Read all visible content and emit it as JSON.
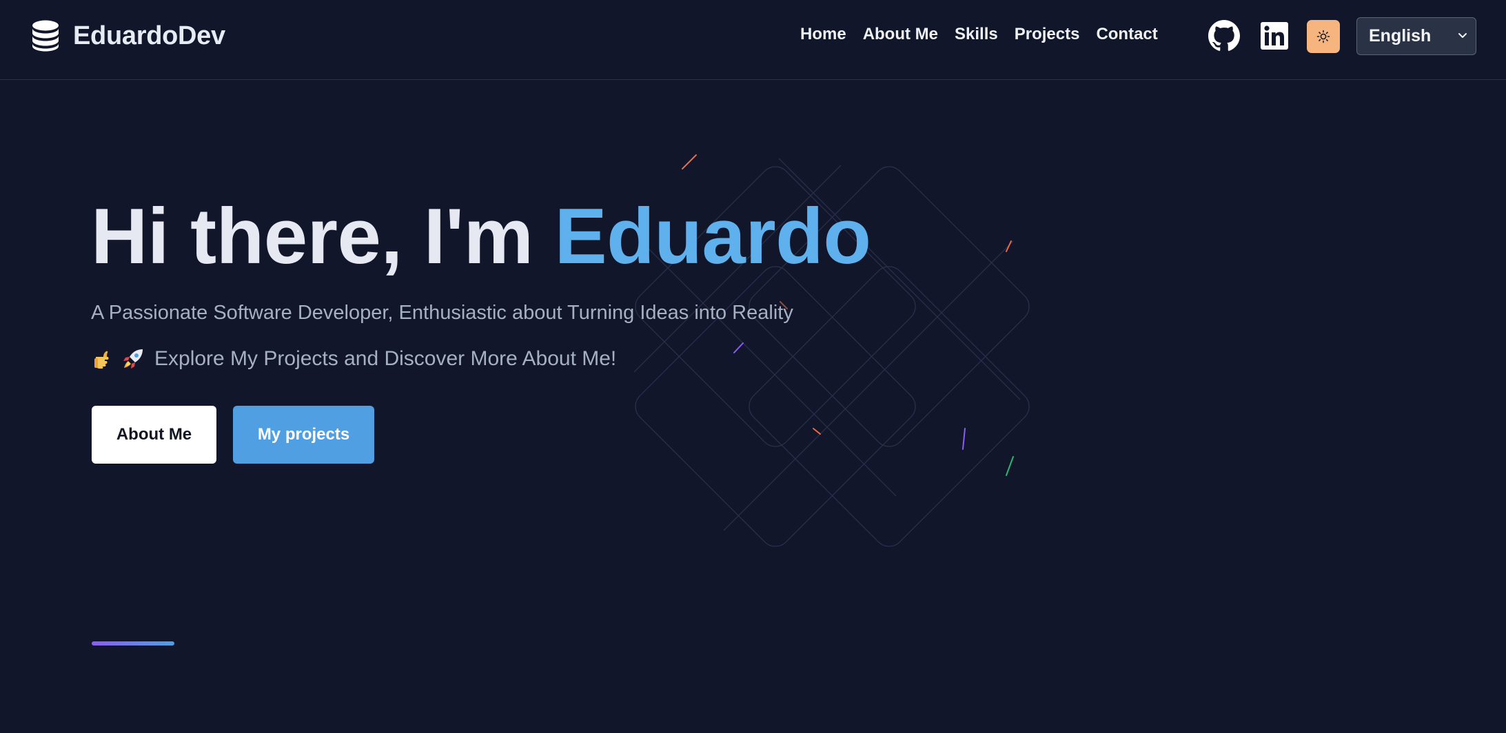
{
  "brand": {
    "name": "EduardoDev",
    "icon": "database-icon"
  },
  "nav": {
    "items": [
      {
        "label": "Home"
      },
      {
        "label": "About Me"
      },
      {
        "label": "Skills"
      },
      {
        "label": "Projects"
      },
      {
        "label": "Contact"
      }
    ]
  },
  "header_actions": {
    "github_icon": "github-icon",
    "linkedin_icon": "linkedin-icon",
    "theme_icon": "sun-icon",
    "language": {
      "selected": "English"
    }
  },
  "hero": {
    "title_prefix": "Hi there, I'm ",
    "title_name": "Eduardo",
    "subtitle": "A Passionate Software Developer, Enthusiastic about Turning Ideas into Reality",
    "cta_text": "Explore My Projects and Discover More About Me!",
    "cta_icons": [
      "pointing-hand-icon",
      "rocket-icon"
    ],
    "buttons": {
      "about": "About Me",
      "projects": "My projects"
    }
  },
  "colors": {
    "background": "#11162a",
    "accent": "#5fb1ee",
    "primary_button": "#4f9fe2",
    "theme_button": "#f6b57f"
  }
}
